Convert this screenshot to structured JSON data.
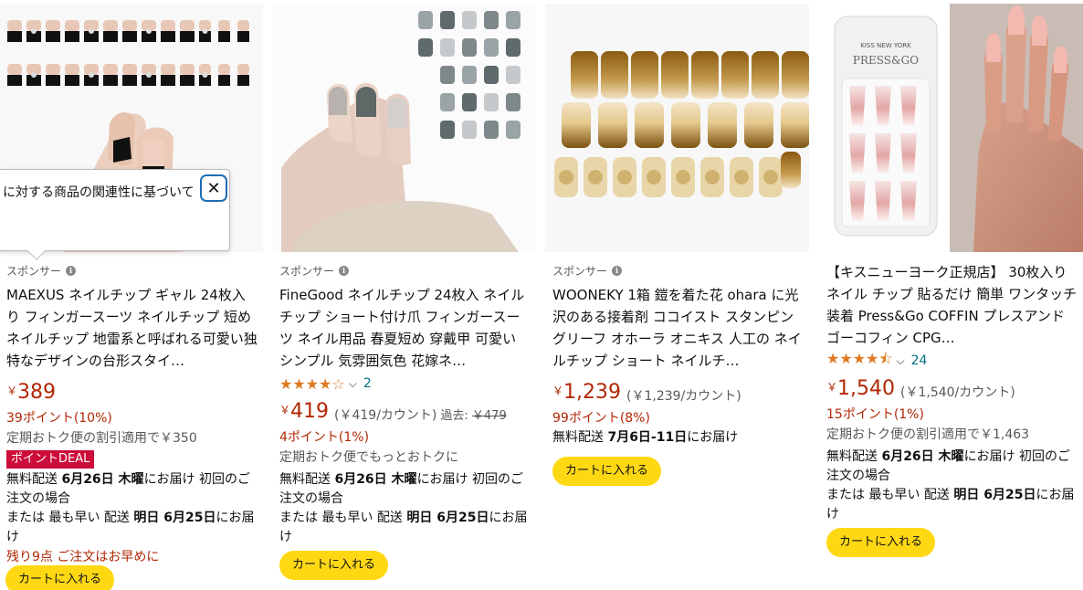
{
  "popup": {
    "text": "に対する商品の関連性に基づいて",
    "close_icon": "close-icon"
  },
  "products": [
    {
      "sponsor": "スポンサー",
      "title": "MAEXUS ネイルチップ ギャル 24枚入り フィンガースーツ ネイルチップ 短め ネイルチップ 地雷系と呼ばれる可愛い独特なデザインの台形スタイ…",
      "yen": "￥",
      "price": "389",
      "points": "39ポイント(10%)",
      "subscribe": "定期おトク便の割引適用で￥350",
      "deal": "ポイントDEAL",
      "ship_a": "無料配送 ",
      "ship_date": "6月26日 木曜",
      "ship_b": "にお届け 初回のご注文の場合",
      "fast_a": "または 最も早い 配送 ",
      "fast_date": "明日 6月25日",
      "fast_b": "にお届け",
      "stock": "残り9点 ご注文はお早めに",
      "cart": "カートに入れる"
    },
    {
      "sponsor": "スポンサー",
      "title": "FineGood ネイルチップ 24枚入 ネイルチップ ショート付け爪 フィンガースーツ ネイル用品 春夏短め 穿戴甲 可愛い シンプル 気雰囲気色 花嫁ネ…",
      "stars": "★★★★☆",
      "rating_count": "2",
      "yen": "￥",
      "price": "419",
      "unit": "(￥419/カウント)",
      "was_label": "過去: ",
      "was_price": "￥479",
      "points": "4ポイント(1%)",
      "subscribe": "定期おトク便でもっとおトクに",
      "ship_a": "無料配送 ",
      "ship_date": "6月26日 木曜",
      "ship_b": "にお届け 初回のご注文の場合",
      "fast_a": "または 最も早い 配送 ",
      "fast_date": "明日 6月25日",
      "fast_b": "にお届け",
      "cart": "カートに入れる"
    },
    {
      "sponsor": "スポンサー",
      "title": "WOONEKY 1箱 鎧を着た花 ohara に光沢のある接着剤 ココイスト スタンピングリーフ オホーラ オニキス 人工の ネイルチップ ショート ネイルチ…",
      "yen": "￥",
      "price": "1,239",
      "unit": "(￥1,239/カウント)",
      "points": "99ポイント(8%)",
      "ship_a": "無料配送 ",
      "ship_date": "7月6日-11日",
      "ship_b": "にお届け",
      "cart": "カートに入れる"
    },
    {
      "title": "【キスニューヨーク正規店】 30枚入り ネイル チップ 貼るだけ 簡単 ワンタッチ 装着 Press&Go COFFIN プレスアンドゴーコフィン CPG…",
      "brand_top": "KISS NEW YORK",
      "brand_main": "PRESS&GO",
      "stars": "★★★★⯪",
      "rating_count": "24",
      "yen": "￥",
      "price": "1,540",
      "unit": "(￥1,540/カウント)",
      "points": "15ポイント(1%)",
      "subscribe": "定期おトク便の割引適用で￥1,463",
      "ship_a": "無料配送 ",
      "ship_date": "6月26日 木曜",
      "ship_b": "にお届け 初回のご注文の場合",
      "fast_a": "または 最も早い 配送 ",
      "fast_date": "明日 6月25日",
      "fast_b": "にお届け",
      "cart": "カートに入れる"
    }
  ]
}
